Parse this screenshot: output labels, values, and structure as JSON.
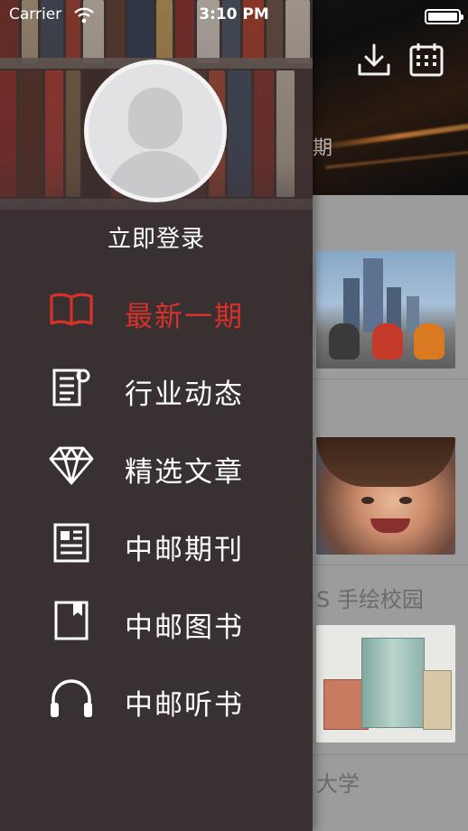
{
  "status_bar": {
    "carrier": "Carrier",
    "time": "3:10 PM"
  },
  "main": {
    "header_partial_text": "期",
    "header_icons": [
      "download-icon",
      "calendar-icon"
    ],
    "cards": [
      {
        "title": "",
        "thumb": "city-bikes"
      },
      {
        "title": "",
        "thumb": "child-face"
      },
      {
        "title": "S 手绘校园",
        "thumb": "campus-sketch"
      },
      {
        "title": "大学",
        "thumb": ""
      }
    ]
  },
  "drawer": {
    "login_label": "立即登录",
    "items": [
      {
        "label": "最新一期",
        "icon": "open-book-icon",
        "active": true
      },
      {
        "label": "行业动态",
        "icon": "news-document-icon",
        "active": false
      },
      {
        "label": "精选文章",
        "icon": "diamond-icon",
        "active": false
      },
      {
        "label": "中邮期刊",
        "icon": "magazine-icon",
        "active": false
      },
      {
        "label": "中邮图书",
        "icon": "book-bookmark-icon",
        "active": false
      },
      {
        "label": "中邮听书",
        "icon": "headphones-icon",
        "active": false
      }
    ]
  },
  "colors": {
    "accent": "#d8302b",
    "drawer_bg": "#393032",
    "text": "#ffffff"
  }
}
